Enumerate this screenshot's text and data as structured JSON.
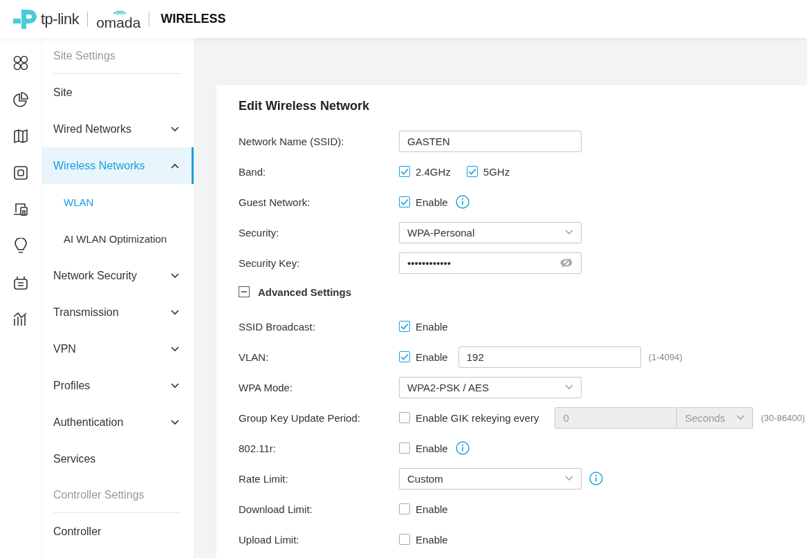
{
  "header": {
    "brand": "tp-link",
    "product": "omada",
    "title": "WIRELESS"
  },
  "sidebar": {
    "items": [
      {
        "kind": "section",
        "label": "Site Settings"
      },
      {
        "kind": "item",
        "label": "Site",
        "selected": false
      },
      {
        "kind": "group",
        "label": "Wired Networks",
        "selected": false,
        "expanded": false
      },
      {
        "kind": "group",
        "label": "Wireless Networks",
        "selected": true,
        "expanded": true,
        "children": [
          {
            "label": "WLAN",
            "selected": true
          },
          {
            "label": "AI WLAN Optimization",
            "selected": false
          }
        ]
      },
      {
        "kind": "group",
        "label": "Network Security",
        "selected": false,
        "expanded": false
      },
      {
        "kind": "group",
        "label": "Transmission",
        "selected": false,
        "expanded": false
      },
      {
        "kind": "group",
        "label": "VPN",
        "selected": false,
        "expanded": false
      },
      {
        "kind": "group",
        "label": "Profiles",
        "selected": false,
        "expanded": false
      },
      {
        "kind": "group",
        "label": "Authentication",
        "selected": false,
        "expanded": false
      },
      {
        "kind": "item",
        "label": "Services",
        "selected": false
      },
      {
        "kind": "section",
        "label": "Controller Settings"
      },
      {
        "kind": "item",
        "label": "Controller",
        "selected": false
      }
    ]
  },
  "form": {
    "title": "Edit Wireless Network",
    "rows": [
      {
        "label": "Network Name (SSID):",
        "controls": [
          {
            "kind": "input",
            "value": "GASTEN",
            "disabled": false
          }
        ]
      },
      {
        "label": "Band:",
        "controls": [
          {
            "kind": "checkbox",
            "label": "2.4GHz",
            "checked": true
          },
          {
            "kind": "checkbox",
            "label": "5GHz",
            "checked": true
          }
        ]
      },
      {
        "label": "Guest Network:",
        "controls": [
          {
            "kind": "checkbox",
            "label": "Enable",
            "checked": true
          },
          {
            "kind": "info"
          }
        ]
      },
      {
        "label": "Security:",
        "controls": [
          {
            "kind": "select",
            "value": "WPA-Personal",
            "disabled": false
          }
        ]
      },
      {
        "label": "Security Key:",
        "controls": [
          {
            "kind": "password",
            "value": "••••••••••••"
          }
        ]
      },
      {
        "kind": "toggle",
        "label": "Advanced Settings",
        "expanded": true
      },
      {
        "label": "SSID Broadcast:",
        "controls": [
          {
            "kind": "checkbox",
            "label": "Enable",
            "checked": true
          }
        ]
      },
      {
        "label": "VLAN:",
        "controls": [
          {
            "kind": "checkbox",
            "label": "Enable",
            "checked": true
          },
          {
            "kind": "input",
            "value": "192",
            "disabled": false
          },
          {
            "kind": "hint",
            "text": "(1-4094)"
          }
        ]
      },
      {
        "label": "WPA Mode:",
        "controls": [
          {
            "kind": "select",
            "value": "WPA2-PSK / AES",
            "disabled": false
          }
        ]
      },
      {
        "label": "Group Key Update Period:",
        "controls": [
          {
            "kind": "checkbox",
            "label": "Enable GIK rekeying every",
            "checked": false
          },
          {
            "kind": "input",
            "value": "0",
            "disabled": true
          },
          {
            "kind": "select",
            "value": "Seconds",
            "disabled": true
          },
          {
            "kind": "hint",
            "text": "(30-86400)"
          }
        ]
      },
      {
        "label": "802.11r:",
        "controls": [
          {
            "kind": "checkbox",
            "label": "Enable",
            "checked": false
          },
          {
            "kind": "info"
          }
        ]
      },
      {
        "label": "Rate Limit:",
        "controls": [
          {
            "kind": "select",
            "value": "Custom",
            "disabled": false
          },
          {
            "kind": "info"
          }
        ]
      },
      {
        "label": "Download Limit:",
        "controls": [
          {
            "kind": "checkbox",
            "label": "Enable",
            "checked": false
          }
        ]
      },
      {
        "label": "Upload Limit:",
        "controls": [
          {
            "kind": "checkbox",
            "label": "Enable",
            "checked": false
          }
        ]
      }
    ]
  }
}
